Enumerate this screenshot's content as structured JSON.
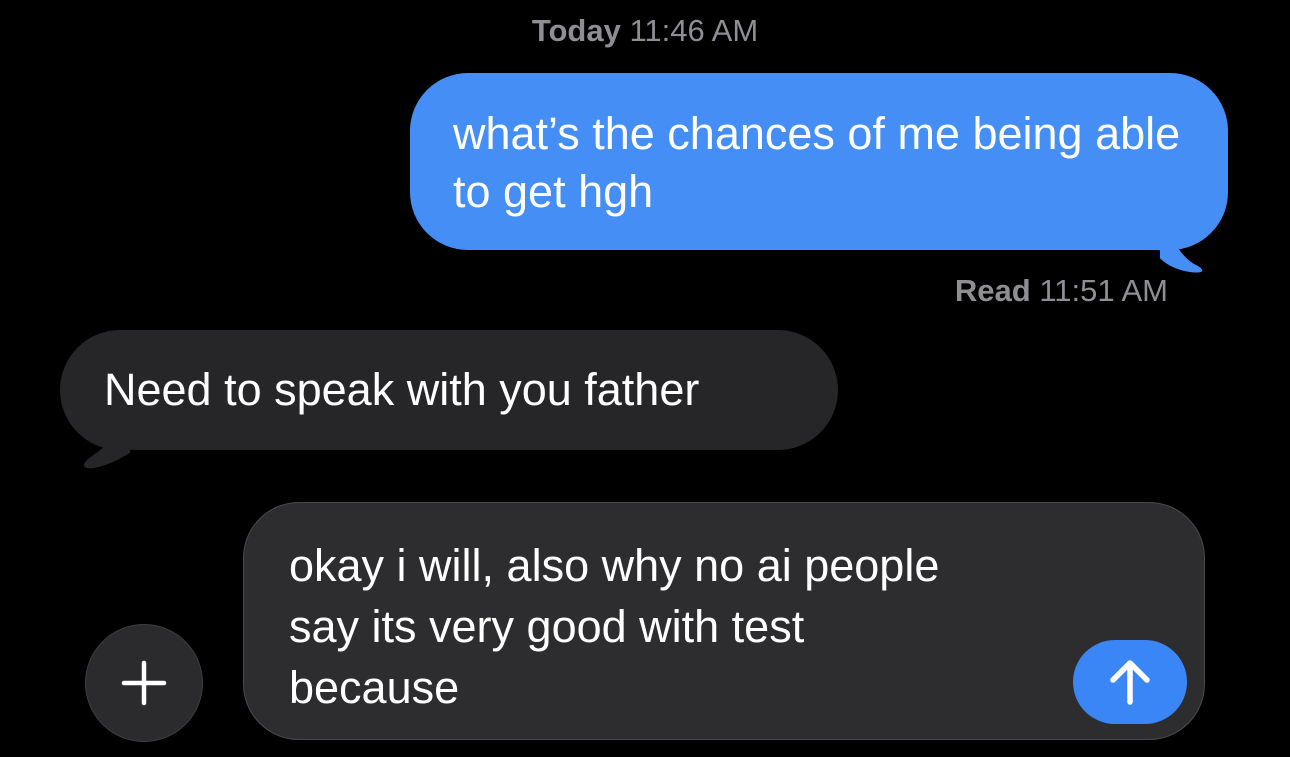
{
  "header": {
    "day": "Today",
    "time": "11:46 AM"
  },
  "messages": [
    {
      "direction": "outgoing",
      "text": "what’s the chances of me being able to get hgh",
      "bubble_color": "#448ef6"
    },
    {
      "direction": "incoming",
      "text": "Need to speak with you father",
      "bubble_color": "#262629"
    }
  ],
  "read_receipt": {
    "label": "Read",
    "time": "11:51 AM"
  },
  "composer": {
    "text": "okay i will, also why no ai people\nsay its very good with test\nbecause",
    "plus_icon": "plus-icon",
    "send_icon": "arrow-up-icon",
    "send_color": "#3b86f7"
  }
}
